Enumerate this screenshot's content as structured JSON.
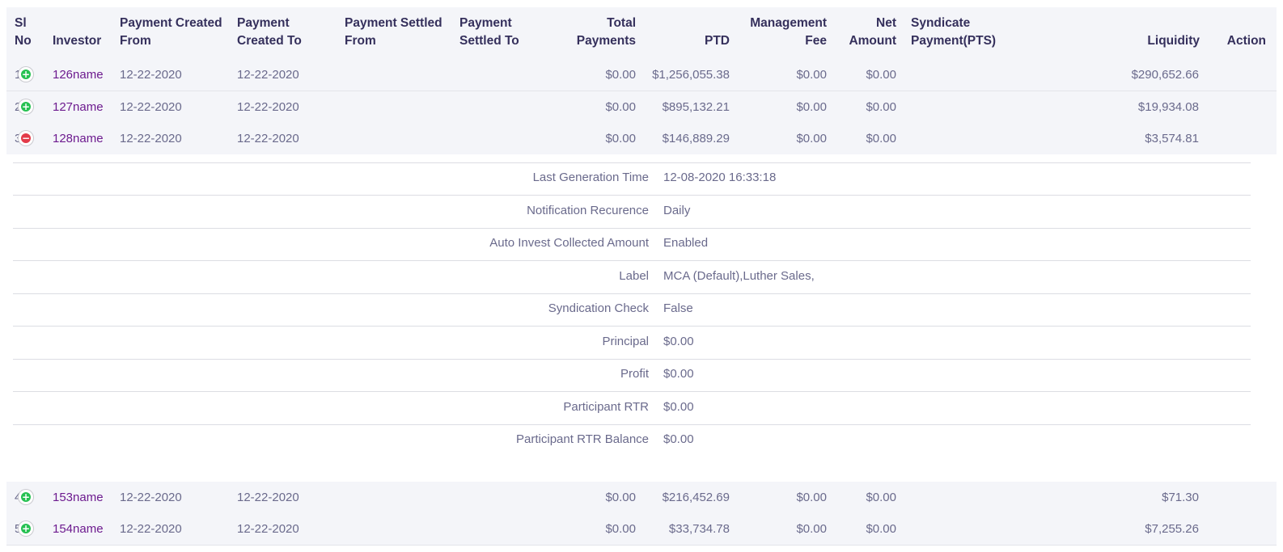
{
  "table": {
    "headers": {
      "sl_no": [
        "Sl",
        "No"
      ],
      "investor": [
        "",
        "Investor"
      ],
      "payment_created_from": [
        "Payment Created",
        "From"
      ],
      "payment_created_to": [
        "Payment",
        "Created To"
      ],
      "payment_settled_from": [
        "Payment Settled",
        "From"
      ],
      "payment_settled_to": [
        "Payment",
        "Settled To"
      ],
      "total_payments": [
        "Total",
        "Payments"
      ],
      "ptd": [
        "",
        "PTD"
      ],
      "management_fee": [
        "Management",
        "Fee"
      ],
      "net_amount": [
        "Net",
        "Amount"
      ],
      "syndicate_payment": [
        "Syndicate",
        "Payment(PTS)"
      ],
      "liquidity": [
        "",
        "Liquidity"
      ],
      "action": [
        "",
        "Action"
      ]
    },
    "rows": [
      {
        "sl": "1",
        "toggle": "plus",
        "investor": "126name",
        "created_from": "12-22-2020",
        "created_to": "12-22-2020",
        "settled_from": "",
        "settled_to": "",
        "total_payments": "$0.00",
        "ptd": "$1,256,055.38",
        "management_fee": "$0.00",
        "net_amount": "$0.00",
        "syndicate_payment": "",
        "liquidity": "$290,652.66"
      },
      {
        "sl": "2",
        "toggle": "plus",
        "investor": "127name",
        "created_from": "12-22-2020",
        "created_to": "12-22-2020",
        "settled_from": "",
        "settled_to": "",
        "total_payments": "$0.00",
        "ptd": "$895,132.21",
        "management_fee": "$0.00",
        "net_amount": "$0.00",
        "syndicate_payment": "",
        "liquidity": "$19,934.08"
      },
      {
        "sl": "3",
        "toggle": "minus",
        "investor": "128name",
        "created_from": "12-22-2020",
        "created_to": "12-22-2020",
        "settled_from": "",
        "settled_to": "",
        "total_payments": "$0.00",
        "ptd": "$146,889.29",
        "management_fee": "$0.00",
        "net_amount": "$0.00",
        "syndicate_payment": "",
        "liquidity": "$3,574.81"
      },
      {
        "sl": "4",
        "toggle": "plus",
        "investor": "153name",
        "created_from": "12-22-2020",
        "created_to": "12-22-2020",
        "settled_from": "",
        "settled_to": "",
        "total_payments": "$0.00",
        "ptd": "$216,452.69",
        "management_fee": "$0.00",
        "net_amount": "$0.00",
        "syndicate_payment": "",
        "liquidity": "$71.30"
      },
      {
        "sl": "5",
        "toggle": "plus",
        "investor": "154name",
        "created_from": "12-22-2020",
        "created_to": "12-22-2020",
        "settled_from": "",
        "settled_to": "",
        "total_payments": "$0.00",
        "ptd": "$33,734.78",
        "management_fee": "$0.00",
        "net_amount": "$0.00",
        "syndicate_payment": "",
        "liquidity": "$7,255.26"
      }
    ],
    "details": [
      {
        "label": "Last Generation Time",
        "value": "12-08-2020 16:33:18"
      },
      {
        "label": "Notification Recurence",
        "value": "Daily"
      },
      {
        "label": "Auto Invest Collected Amount",
        "value": "Enabled"
      },
      {
        "label": "Label",
        "value": "MCA (Default),Luther Sales,"
      },
      {
        "label": "Syndication Check",
        "value": "False"
      },
      {
        "label": "Principal",
        "value": "$0.00"
      },
      {
        "label": "Profit",
        "value": "$0.00"
      },
      {
        "label": "Participant RTR",
        "value": "$0.00"
      },
      {
        "label": "Participant RTR Balance",
        "value": "$0.00"
      }
    ]
  },
  "icons": {
    "expand": "plus-circle-icon",
    "collapse": "minus-circle-icon"
  },
  "colors": {
    "header_bg": "#f4f5f9",
    "investor_link": "#6d1b8f",
    "expand": "#26c152",
    "collapse": "#e33b49"
  }
}
